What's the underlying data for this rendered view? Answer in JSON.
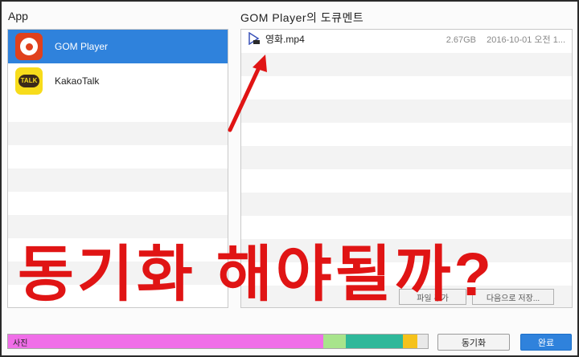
{
  "header": {
    "left_title": "App",
    "right_title": "GOM  Player의 도큐멘트"
  },
  "apps": [
    {
      "label": "GOM Player",
      "icon": "gom-player-icon",
      "selected": true
    },
    {
      "label": "KakaoTalk",
      "icon": "kakaotalk-icon",
      "selected": false
    }
  ],
  "kakao_icon_text": "TALK",
  "files": [
    {
      "name": "영화.mp4",
      "size": "2.67GB",
      "date": "2016-10-01 오전 1..."
    }
  ],
  "overlay": {
    "text": "동기화 해야될까?"
  },
  "hidden_buttons": {
    "add_file": "파일 추가",
    "save_to": "다음으로 저장..."
  },
  "storage": {
    "label": "사진",
    "segments": [
      {
        "color": "#f06ee8",
        "fraction": 0.75
      },
      {
        "color": "#a8e48c",
        "fraction": 0.055
      },
      {
        "color": "#2fb89a",
        "fraction": 0.135
      },
      {
        "color": "#f5c21b",
        "fraction": 0.035
      }
    ]
  },
  "buttons": {
    "sync": "동기화",
    "done": "완료"
  },
  "colors": {
    "selection": "#2f82dc",
    "overlay_text": "#e01414",
    "arrow": "#e01414"
  }
}
